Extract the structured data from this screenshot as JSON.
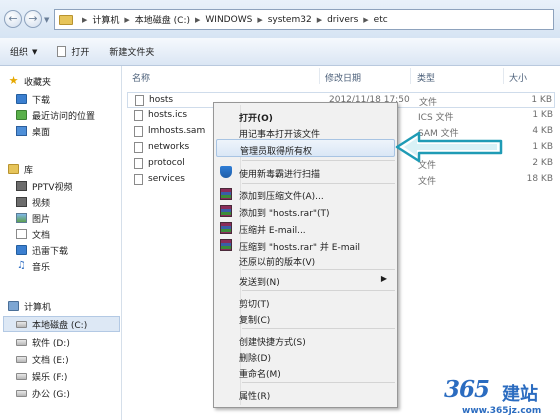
{
  "address": {
    "back_icon": "back-arrow-icon",
    "forward_icon": "forward-arrow-icon",
    "recent_icon": "chevron-down-icon",
    "crumbs": [
      "计算机",
      "本地磁盘 (C:)",
      "WINDOWS",
      "system32",
      "drivers",
      "etc"
    ]
  },
  "toolbar": {
    "organize": "组织",
    "open": "打开",
    "new_folder": "新建文件夹"
  },
  "nav": {
    "favorites": "收藏夹",
    "downloads": "下载",
    "recent": "最近访问的位置",
    "desktop": "桌面",
    "library": "库",
    "pptv": "PPTV视频",
    "video": "视频",
    "pictures": "图片",
    "documents": "文档",
    "xunlei": "迅雷下载",
    "music": "音乐",
    "computer": "计算机",
    "drive_c": "本地磁盘 (C:)",
    "drive_d": "软件 (D:)",
    "drive_e": "文档 (E:)",
    "drive_f": "娱乐 (F:)",
    "drive_g": "办公 (G:)"
  },
  "columns": {
    "name": "名称",
    "date": "修改日期",
    "type": "类型",
    "size": "大小"
  },
  "files": [
    {
      "name": "hosts",
      "date": "2012/11/18 17:50",
      "type": "文件",
      "size": "1 KB"
    },
    {
      "name": "hosts.ics",
      "date": "",
      "type": "ICS 文件",
      "size": "1 KB"
    },
    {
      "name": "lmhosts.sam",
      "date": "",
      "type": "SAM 文件",
      "size": "4 KB"
    },
    {
      "name": "networks",
      "date": "",
      "type": "文件",
      "size": "1 KB"
    },
    {
      "name": "protocol",
      "date": "",
      "type": "文件",
      "size": "2 KB"
    },
    {
      "name": "services",
      "date": "",
      "type": "文件",
      "size": "18 KB"
    }
  ],
  "menu": {
    "open": "打开(O)",
    "open_notepad": "用记事本打开该文件",
    "take_ownership": "管理员取得所有权",
    "scan": "使用新毒霸进行扫描",
    "add_archive": "添加到压缩文件(A)...",
    "add_rar": "添加到 \"hosts.rar\"(T)",
    "compress_email": "压缩并 E-mail...",
    "compress_rar_email": "压缩到 \"hosts.rar\" 并 E-mail",
    "restore": "还原以前的版本(V)",
    "send_to": "发送到(N)",
    "cut": "剪切(T)",
    "copy": "复制(C)",
    "create_shortcut": "创建快捷方式(S)",
    "delete": "删除(D)",
    "rename": "重命名(M)",
    "properties": "属性(R)"
  },
  "watermark": {
    "logo": "365",
    "brand": "建站",
    "url": "www.365jz.com"
  },
  "colors": {
    "highlight_arrow": "#1f9bb5",
    "selection": "#dae7f6"
  }
}
